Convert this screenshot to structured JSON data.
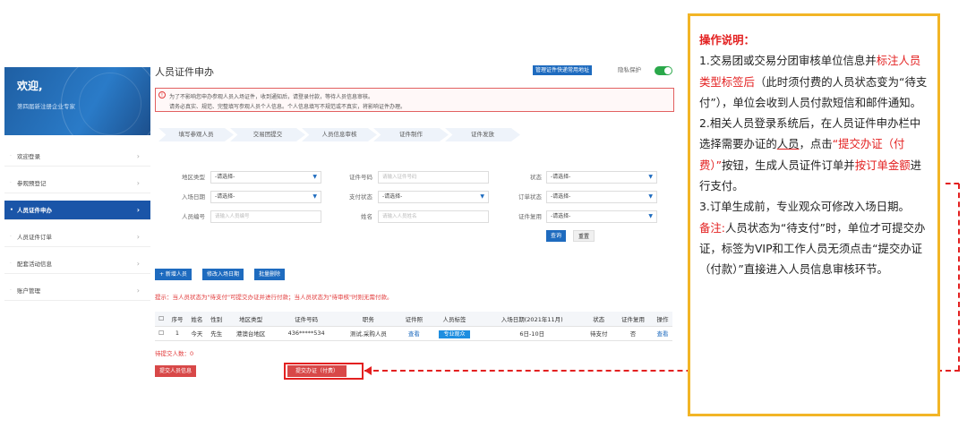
{
  "sidebar": {
    "welcome_title": "欢迎,",
    "welcome_subtitle": "第四届新注册企业专家",
    "items": [
      {
        "label": "欢迎登录"
      },
      {
        "label": "参观预登记"
      },
      {
        "label": "人员证件申办"
      },
      {
        "label": "人员证件订单"
      },
      {
        "label": "配套活动信息"
      },
      {
        "label": "账户管理"
      }
    ]
  },
  "header": {
    "title": "人员证件申办",
    "mgmt_button": "管理证件快递常用地址",
    "privacy_label": "隐私保护"
  },
  "notice": {
    "line1": "为了不影响您申办参观人员入场证件，收到通知后，请登录付款，等待人员信息审核。",
    "line2": "请务必真实、规范、完整填写参观人员个人信息。个人信息填写不规范或不真实，将影响证件办理。"
  },
  "steps": [
    "填写参观人员",
    "交易团提交",
    "人员信息审核",
    "证件制作",
    "证件发放"
  ],
  "filters": {
    "region_label": "地区类型",
    "region_value": "-请选择-",
    "idno_label": "证件号码",
    "idno_placeholder": "请输入证件号码",
    "status_label": "状态",
    "status_value": "-请选择-",
    "date_label": "入场日期",
    "date_value": "-请选择-",
    "paystatus_label": "支付状态",
    "paystatus_value": "-请选择-",
    "orderstatus_label": "订单状态",
    "orderstatus_value": "-请选择-",
    "pno_label": "人员编号",
    "pno_placeholder": "请输入人员编号",
    "name_label": "姓名",
    "name_placeholder": "请输入人员姓名",
    "reuse_label": "证件复用",
    "reuse_value": "-请选择-",
    "query_button": "查询",
    "reset_button": "重置"
  },
  "actions": {
    "add": "+ 新增人员",
    "modify_date": "修改入场日期",
    "batch_delete": "批量删除"
  },
  "tip": "提示：当人员状态为\"待支付\"可提交办证并进行付款；当人员状态为\"待审核\"时则无需付款。",
  "table": {
    "headers": [
      "",
      "序号",
      "姓名",
      "性别",
      "地区类型",
      "证件号码",
      "职务",
      "证件照",
      "人员标签",
      "入场日期(2021年11月)",
      "状态",
      "证件复用",
      "操作"
    ],
    "rows": [
      {
        "seq": "1",
        "name": "今天",
        "gender": "先生",
        "region": "港澳台地区",
        "idno": "436*****534",
        "title": "测试,采购人员",
        "photo": "查看",
        "tag": "专业观众",
        "date": "6日-10日",
        "status": "待支付",
        "reuse": "否",
        "op": "查看"
      }
    ]
  },
  "pending": "待提交人数：0",
  "submit_info_button": "提交人员信息",
  "submit_pay_button": "提交办证（付费）",
  "instructions": {
    "heading": "操作说明：",
    "p1a": "1.交易团或交易分团审核单位信息并",
    "p1b": "标注人员类型标签后",
    "p1c": "（此时须付费的人员状态变为“待支付”），单位会收到人员付款短信和邮件通知。",
    "p2a": "2.相关人员登录系统后，在人员证件申办栏中选择需要办证的",
    "p2b": "人员",
    "p2c": "，点击",
    "p2d": "“提交办证（付费）”",
    "p2e": "按钮，生成人员证件订单并",
    "p2f": "按订单金额",
    "p2g": "进行支付。",
    "p3": "3.订单生成前，专业观众可修改入场日期。",
    "p4a": "备注:",
    "p4b": "人员状态为“待支付”时，单位才可提交办证，标签为VIP和工作人员无须点击“提交办证（付款）”直接进入人员信息审核环节。"
  },
  "colors": {
    "accent": "#1e6bbf",
    "alert": "#e32020",
    "frame": "#f2b526"
  }
}
